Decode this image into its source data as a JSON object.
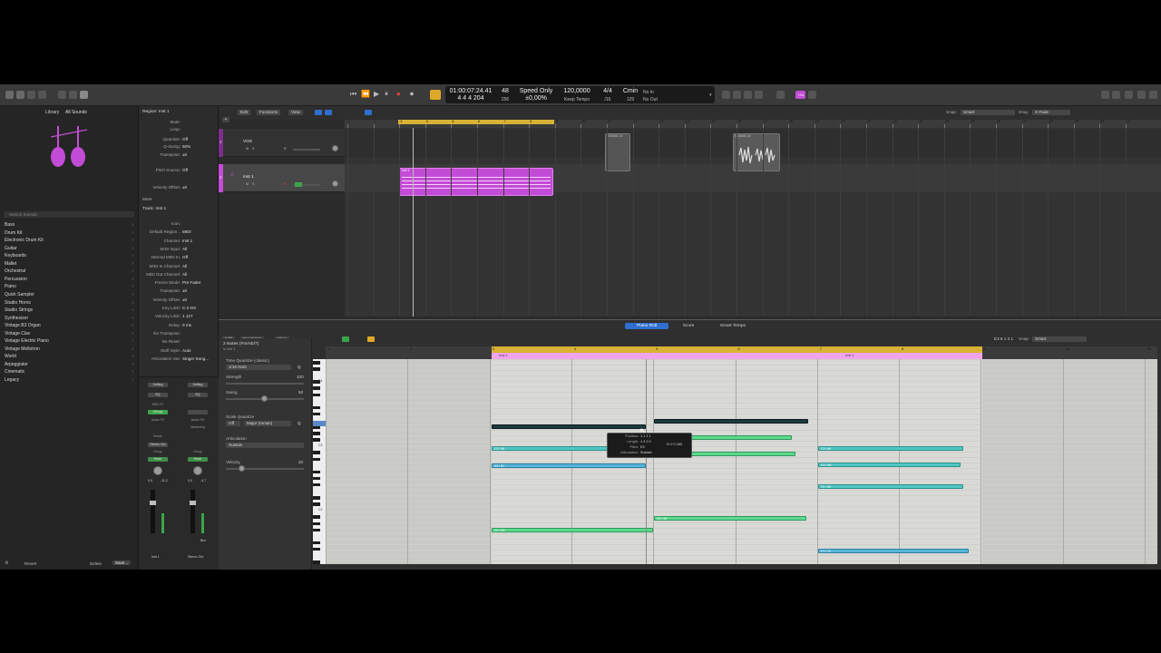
{
  "transport": {
    "position_time": "01:00:07:24.41",
    "position_bars": "4  4  4  204",
    "bar_top": "48",
    "bar_bottom": "256",
    "speed_mode": "Speed Only",
    "speed_value": "±0,00%",
    "tempo": "120,0000",
    "tempo_mode": "Keep Tempo",
    "signature": "4/4",
    "division": "/16",
    "key": "Cmin",
    "key_sub": "129",
    "midi_in": "No In",
    "midi_out": "No Out",
    "badge": "+34"
  },
  "library": {
    "title": "Library",
    "subtitle": "All Sounds",
    "search_placeholder": "Search Sounds",
    "items": [
      "Bass",
      "Drum Kit",
      "Electronic Drum Kit",
      "Guitar",
      "Keyboards",
      "Mallet",
      "Orchestral",
      "Percussion",
      "Piano",
      "Quick Sampler",
      "Studio Horns",
      "Studio Strings",
      "Synthesizer",
      "Vintage B3 Organ",
      "Vintage Clav",
      "Vintage Electric Piano",
      "Vintage Mellotron",
      "World",
      "Arpeggiator",
      "Cinematic",
      "Legacy"
    ],
    "revert": "Revert",
    "delete": "Delete",
    "save": "Save..."
  },
  "inspector": {
    "region_header": "Region: Inst 1",
    "region_rows": [
      {
        "label": "Mute:",
        "value": ""
      },
      {
        "label": "Loop:",
        "value": ""
      },
      {
        "label": "Quantize:",
        "value": "Off"
      },
      {
        "label": "Q-Swing:",
        "value": "50%"
      },
      {
        "label": "Transpose:",
        "value": "±0"
      },
      {
        "label": "Pitch Source:",
        "value": "Off"
      },
      {
        "label": "Velocity Offset:",
        "value": "±0"
      }
    ],
    "more": "More",
    "track_header": "Track: Inst 1",
    "track_rows": [
      {
        "label": "Icon:",
        "value": ""
      },
      {
        "label": "Default Region...",
        "value": "MIDI"
      },
      {
        "label": "Channel:",
        "value": "Inst 1"
      },
      {
        "label": "MIDI Input:",
        "value": "All"
      },
      {
        "label": "Internal MIDI In:",
        "value": "Off"
      },
      {
        "label": "MIDI In Channel:",
        "value": "All"
      },
      {
        "label": "MIDI Out Channel:",
        "value": "All"
      },
      {
        "label": "Freeze Mode:",
        "value": "Pre Fader"
      },
      {
        "label": "Transpose:",
        "value": "±0"
      },
      {
        "label": "Velocity Offset:",
        "value": "±0"
      },
      {
        "label": "Key Limit:",
        "value": "C-2  G8"
      },
      {
        "label": "Velocity Limit:",
        "value": "1  127"
      },
      {
        "label": "Delay:",
        "value": "0 ms"
      },
      {
        "label": "No Transpose:",
        "value": ""
      },
      {
        "label": "No Reset:",
        "value": ""
      },
      {
        "label": "Staff Style:",
        "value": "Auto"
      },
      {
        "label": "Articulation Set:",
        "value": "Singer Song..."
      }
    ],
    "strip1": {
      "setting": "Setting",
      "eq": "EQ",
      "midi_fx": "MIDI FX",
      "instrument": "Strings",
      "audio_fx": "Audio FX",
      "sends": "Sends",
      "output": "Stereo Out",
      "group": "Group",
      "automation": "Read",
      "vol": "0,0",
      "pan": "-11,2",
      "name": "Inst 1"
    },
    "strip2": {
      "setting": "Setting",
      "eq": "EQ",
      "audio_fx": "Audio FX",
      "mastering": "Mastering",
      "group": "Group",
      "automation": "Read",
      "vol": "0,0",
      "pan": "-4,7",
      "bnc": "Bnc",
      "name": "Stereo Out"
    }
  },
  "tracks": {
    "edit": "Edit",
    "functions": "Functions",
    "view": "View",
    "snap_label": "Snap:",
    "snap_value": "Smart",
    "drag_label": "Drag:",
    "drag_value": "X-Fade",
    "ruler": [
      "1",
      "2",
      "3",
      "4",
      "5",
      "6",
      "7",
      "8",
      "9",
      "10",
      "11",
      "12",
      "13",
      "14",
      "15",
      "16",
      "17",
      "18",
      "19",
      "20",
      "21",
      "22",
      "23",
      "24",
      "25",
      "26",
      "27",
      "28",
      "29",
      "30",
      "31"
    ],
    "list": [
      {
        "num": "1",
        "name": "VOX",
        "m": "M",
        "s": "S",
        "r": "R"
      },
      {
        "num": "2",
        "name": "Inst 1",
        "m": "M",
        "s": "S",
        "r": "R"
      }
    ],
    "regions": [
      {
        "name": "Inst 1"
      },
      {
        "name": "VOX#01.10"
      },
      {
        "name": "VOX#01.10"
      }
    ]
  },
  "editor": {
    "tabs": [
      "Piano Roll",
      "Score",
      "Smart Tempo"
    ],
    "edit": "Edit",
    "functions": "Functions",
    "view": "View",
    "pos_readout": "E3  6 1 3 1",
    "snap_label": "Snap:",
    "snap_value": "Smart",
    "selection": "2 Notes (Fm/Ab/7)",
    "track_ref": "in Inst 1",
    "time_quantize_label": "Time Quantize (classic)",
    "time_quantize_value": "1/16 Note",
    "q_btn": "Q",
    "strength_label": "Strength",
    "strength_value": "100",
    "swing_label": "Swing",
    "swing_value": "50",
    "scale_label": "Scale Quantize",
    "scale_off": "Off",
    "scale_value": "Major (Ionian)",
    "articulation_label": "Articulation",
    "articulation_value": "Sustain",
    "velocity_label": "Velocity",
    "velocity_value": "20",
    "keyboard_labels": [
      "C4",
      "C3",
      "C2"
    ],
    "ruler": [
      "1",
      "2",
      "3",
      "4",
      "5",
      "6",
      "7",
      "8",
      "9",
      "10",
      "11"
    ],
    "region_label_1": "Inst 1",
    "region_label_2": "Inst 1",
    "tooltip": {
      "position_k": "Position:",
      "position_v": "1 1 1 1",
      "length_k": "Length:",
      "length_v": "1 3 2 0",
      "pitch_k": "Pitch:",
      "pitch_v": "E3",
      "articulation_k": "Articulation:",
      "articulation_v": "Sustain",
      "delta": "+0 2 0 160"
    },
    "notes": [
      {
        "label": "",
        "color": "sel"
      },
      {
        "label": "",
        "color": "sel"
      },
      {
        "label": "C3 | 56",
        "color": "teal"
      },
      {
        "label": "",
        "color": "green"
      },
      {
        "label": "",
        "color": "green"
      },
      {
        "label": "A2 | 81",
        "color": "blue"
      },
      {
        "label": "C3 | 66",
        "color": "teal"
      },
      {
        "label": "G2 | 66",
        "color": "teal"
      },
      {
        "label": "F2 | 66",
        "color": "teal"
      },
      {
        "label": "D2 | 66",
        "color": "green"
      },
      {
        "label": "G1 | 69",
        "color": "green"
      },
      {
        "label": "F1 | 72",
        "color": "blue"
      }
    ]
  },
  "colors": {
    "accent": "#c34cd6",
    "ruler_cycle": "#d8b234",
    "region_pink": "#f0a4ea",
    "selected_tab": "#2f6fcf"
  }
}
